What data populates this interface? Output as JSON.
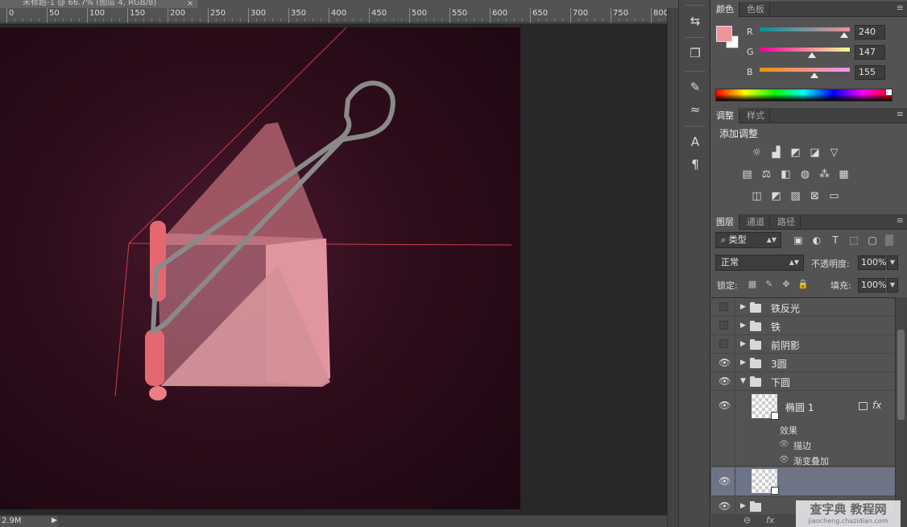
{
  "document": {
    "tab_title": "未标题-1 @ 66.7% (图层 4, RGB/8)",
    "close_glyph": "×",
    "ruler_labels": [
      "0",
      "50",
      "100",
      "150",
      "200",
      "250",
      "300",
      "350",
      "400",
      "450",
      "500",
      "550",
      "600",
      "650",
      "700",
      "750",
      "800"
    ],
    "doc_size": "2.9M"
  },
  "color_panel": {
    "tabs": [
      "颜色",
      "色板"
    ],
    "foreground": "#f0939b",
    "background": "#ffffff",
    "channels": [
      {
        "label": "R",
        "value": "240",
        "level": 240
      },
      {
        "label": "G",
        "value": "147",
        "level": 147
      },
      {
        "label": "B",
        "value": "155",
        "level": 155
      }
    ]
  },
  "adjust_panel": {
    "tabs": [
      "调整",
      "样式"
    ],
    "title": "添加调整",
    "icons": [
      [
        "brightness-icon",
        "levels-icon",
        "curves-icon",
        "exposure-icon",
        "vibrance-icon"
      ],
      [
        "hue-sat-icon",
        "color-balance-icon",
        "black-white-icon",
        "photo-filter-icon",
        "channel-mixer-icon",
        "color-lookup-icon"
      ],
      [
        "invert-icon",
        "posterize-icon",
        "threshold-icon",
        "selective-color-icon",
        "gradient-map-icon"
      ]
    ]
  },
  "layers_panel": {
    "tabs": [
      "图层",
      "通道",
      "路径"
    ],
    "filter_label": "类型",
    "blend_mode": "正常",
    "opacity_label": "不透明度:",
    "opacity": "100%",
    "lock_label": "锁定:",
    "fill_label": "填充:",
    "fill": "100%",
    "layers": [
      {
        "name": "铁反光",
        "visible": false,
        "type": "group"
      },
      {
        "name": "铁",
        "visible": false,
        "type": "group"
      },
      {
        "name": "前阴影",
        "visible": false,
        "type": "group"
      },
      {
        "name": "3圆",
        "visible": true,
        "type": "group"
      },
      {
        "name": "下圆",
        "visible": true,
        "type": "group-open"
      }
    ],
    "child_layer": {
      "name": "椭圆 1",
      "effects_label": "效果",
      "effects": [
        "描边",
        "渐变叠加"
      ]
    }
  },
  "watermark": {
    "main": "查字典 教程网",
    "sub": "jiaocheng.chazidian.com"
  }
}
